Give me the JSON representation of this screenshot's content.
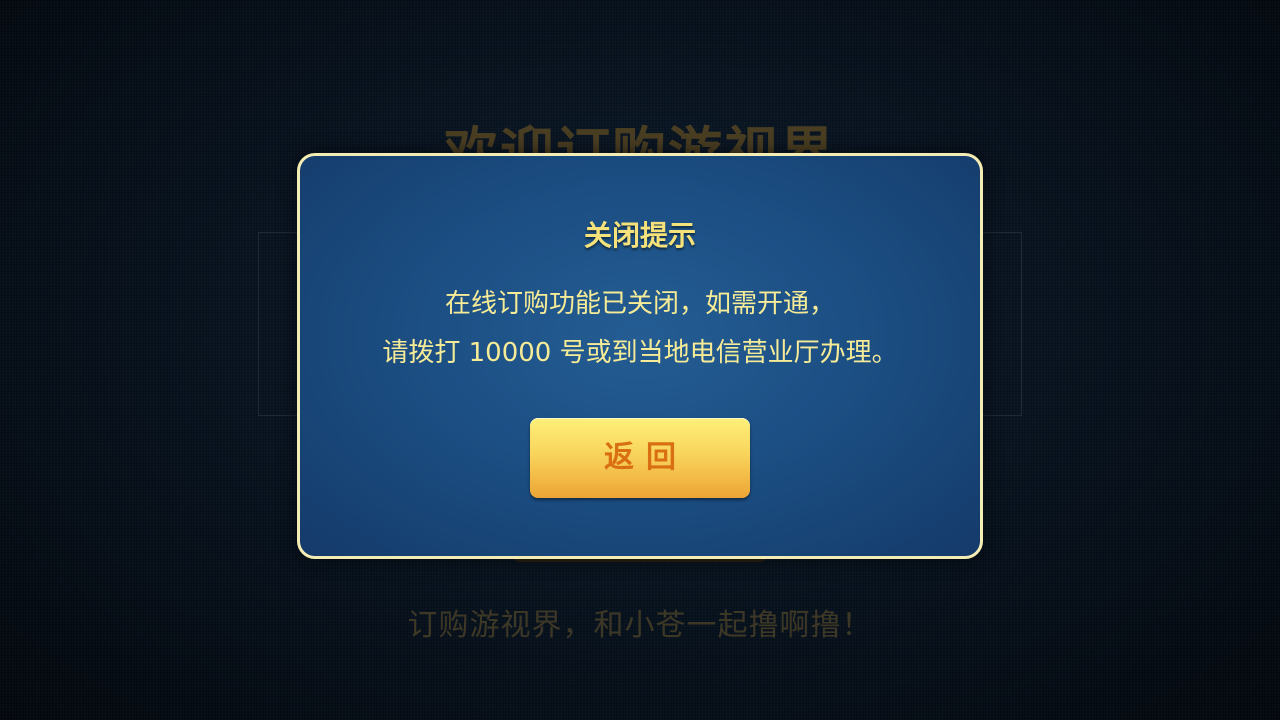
{
  "background": {
    "title": "欢迎订购游视界",
    "slogan": "订购游视界，和小苍一起撸啊撸！"
  },
  "dialog": {
    "title": "关闭提示",
    "message_line1": "在线订购功能已关闭，如需开通，",
    "message_line2": "请拨打 10000 号或到当地电信营业厅办理。",
    "return_label": "返回"
  },
  "colors": {
    "dialog_bg": "#1c4f84",
    "dialog_border": "#f3ecb4",
    "title_text": "#f5e27a",
    "message_text": "#f6eb96",
    "button_top": "#fdf07a",
    "button_bottom": "#eda534",
    "button_text": "#d96f12"
  }
}
